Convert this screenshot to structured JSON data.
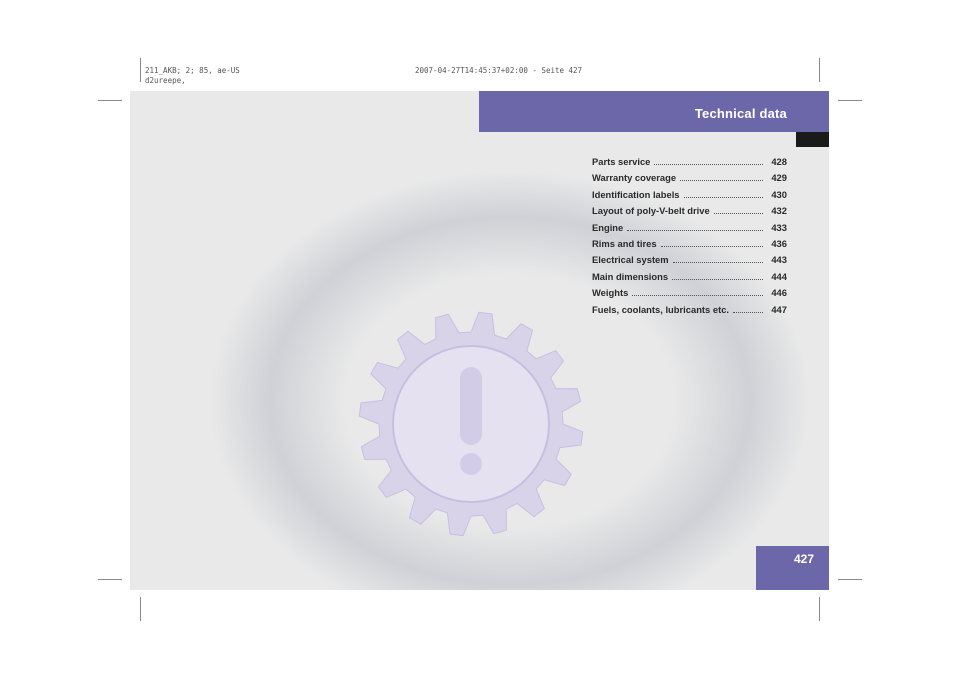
{
  "print_meta": {
    "left_line1": "211_AKB; 2; 85, ae-US",
    "left_line2": "d2ureepe,",
    "right_line1": "2007-04-27T14:45:37+02:00 - Seite 427"
  },
  "header": {
    "title": "Technical data"
  },
  "page_number": "427",
  "toc": [
    {
      "label": "Parts service",
      "page": "428"
    },
    {
      "label": "Warranty coverage",
      "page": "429"
    },
    {
      "label": "Identification labels",
      "page": "430"
    },
    {
      "label": "Layout of poly-V-belt drive",
      "page": "432"
    },
    {
      "label": "Engine",
      "page": "433"
    },
    {
      "label": "Rims and tires",
      "page": "436"
    },
    {
      "label": "Electrical system",
      "page": "443"
    },
    {
      "label": "Main dimensions",
      "page": "444"
    },
    {
      "label": "Weights",
      "page": "446"
    },
    {
      "label": "Fuels, coolants, lubricants etc.",
      "page": "447"
    }
  ],
  "icons": {
    "emblem": "gear-warning-icon"
  },
  "colors": {
    "accent": "#6c67a9",
    "page_bg": "#e9e9e9",
    "gear": "#d9d3ea"
  }
}
